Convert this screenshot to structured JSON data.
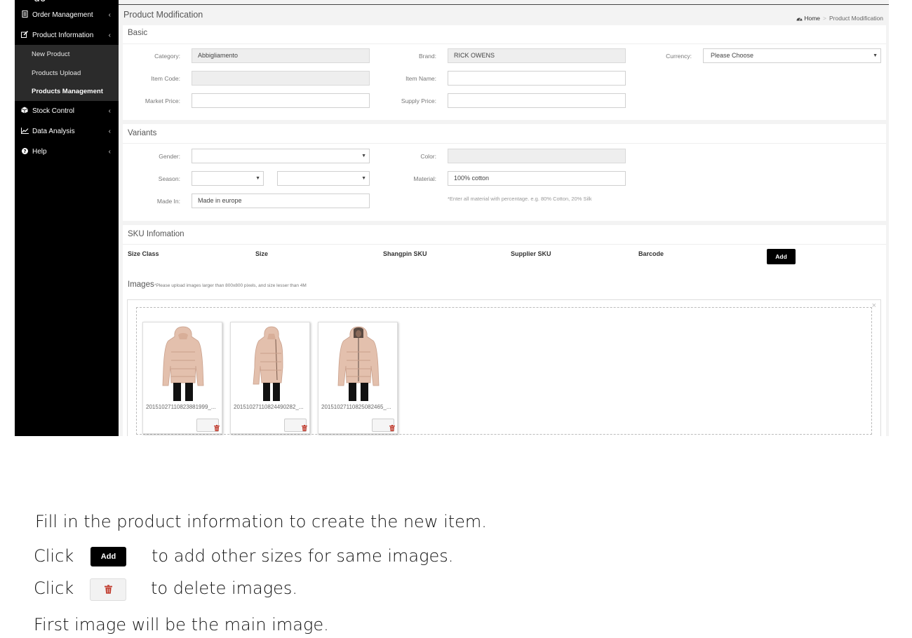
{
  "sidebar": {
    "logo_fragment": "do",
    "items": [
      {
        "label": "Order Management",
        "icon": "document-icon",
        "chevron": "‹"
      },
      {
        "label": "Product Information",
        "icon": "edit-icon",
        "chevron": "‹"
      },
      {
        "label": "Stock Control",
        "icon": "cube-icon",
        "chevron": "‹"
      },
      {
        "label": "Data Analysis",
        "icon": "line-chart-icon",
        "chevron": "‹"
      },
      {
        "label": "Help",
        "icon": "question-circle-icon",
        "chevron": "‹"
      }
    ],
    "sub_items": [
      {
        "label": "New Product"
      },
      {
        "label": "Products Upload"
      },
      {
        "label": "Products Management"
      }
    ]
  },
  "header": {
    "title": "Product Modification",
    "breadcrumb_home": "Home",
    "breadcrumb_separator": ">",
    "breadcrumb_current": "Product Modification"
  },
  "basic": {
    "title": "Basic",
    "category_label": "Category:",
    "category_value": "Abbigliamento",
    "brand_label": "Brand:",
    "brand_value": "RICK OWENS",
    "currency_label": "Currency:",
    "currency_value": "Please Choose",
    "item_code_label": "Item Code:",
    "item_code_value": "",
    "item_name_label": "Item Name:",
    "item_name_value": "",
    "market_price_label": "Market Price:",
    "market_price_value": "",
    "supply_price_label": "Supply Price:",
    "supply_price_value": ""
  },
  "variants": {
    "title": "Variants",
    "gender_label": "Gender:",
    "gender_value": "",
    "color_label": "Color:",
    "color_value": "",
    "season_label": "Season:",
    "season_value_1": "",
    "season_value_2": "",
    "material_label": "Material:",
    "material_value": "100% cotton",
    "made_in_label": "Made In:",
    "made_in_value": "Made in europe",
    "material_hint": "*Enter all material with percentage. e.g. 80% Cotton, 20% Silk"
  },
  "sku": {
    "title": "SKU Infomation",
    "columns": [
      "Size Class",
      "Size",
      "Shangpin SKU",
      "Supplier SKU",
      "Barcode"
    ],
    "add_label": "Add"
  },
  "images": {
    "title": "Images",
    "note": "*Please upload images larger than 800x800 pixels, and size lesser than 4M",
    "close_glyph": "×",
    "items": [
      {
        "caption": "20151027110823881999_..."
      },
      {
        "caption": "20151027110824490282_..."
      },
      {
        "caption": "20151027110825082465_..."
      }
    ],
    "jacket_color": "#e3c0ad"
  },
  "instructions": {
    "line1": "Fill in the product information to create the new item.",
    "click1": "Click",
    "add_demo_label": "Add",
    "line2_rest": "to add other sizes for same images.",
    "click2": "Click",
    "line3_rest": "to delete images.",
    "line4": "First image will be the main image."
  },
  "colors": {
    "sidebar_bg": "#000000",
    "submenu_bg": "#2b2b2b",
    "content_bg": "#f3f3f3",
    "trash_red": "#c0392b"
  }
}
